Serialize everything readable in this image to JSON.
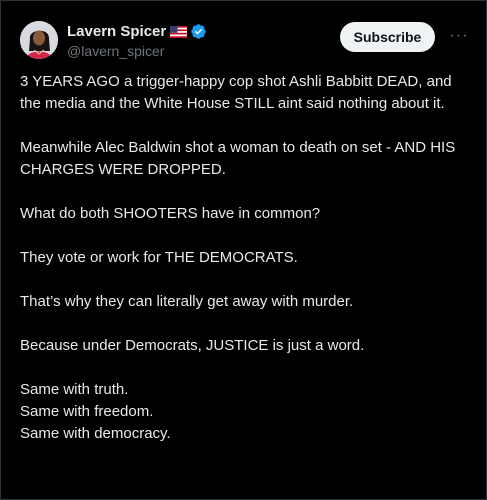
{
  "author": {
    "display_name": "Lavern Spicer",
    "flag": "🇺🇸",
    "handle": "@lavern_spicer",
    "avatar_icon": "user-avatar"
  },
  "actions": {
    "subscribe_label": "Subscribe",
    "more_label": "···"
  },
  "post": {
    "paragraphs": [
      [
        "3 YEARS AGO a trigger-happy cop shot Ashli Babbitt DEAD, and the media and the White House STILL aint said nothing about it."
      ],
      [
        "Meanwhile Alec Baldwin shot a woman to death on set - AND HIS CHARGES WERE DROPPED."
      ],
      [
        "What do both SHOOTERS have in common?"
      ],
      [
        "They vote or work for THE DEMOCRATS."
      ],
      [
        "That’s why they can literally get away with murder."
      ],
      [
        "Because under Democrats, JUSTICE is just a word."
      ],
      [
        "Same with truth.",
        "Same with freedom.",
        "Same with democracy."
      ]
    ]
  },
  "colors": {
    "background": "#000000",
    "text": "#e7e9ea",
    "muted": "#71767b",
    "verified_blue": "#1d9bf0",
    "button_bg": "#eff3f4"
  }
}
